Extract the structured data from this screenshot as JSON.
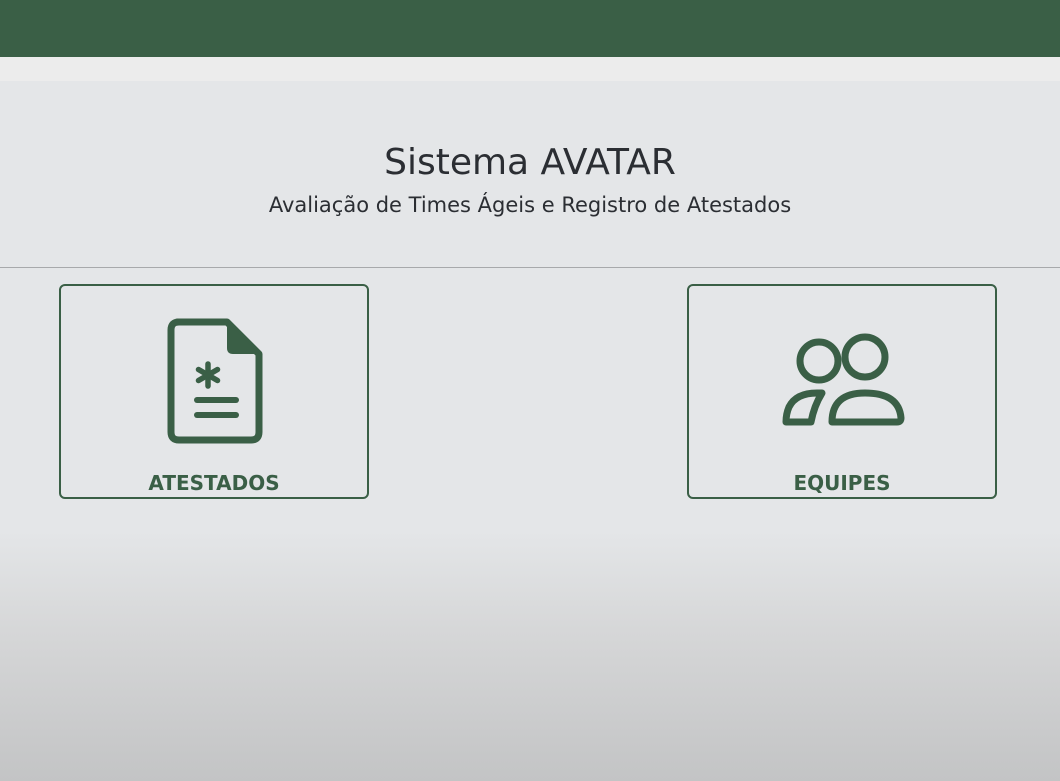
{
  "header": {
    "title": "Sistema AVATAR",
    "subtitle": "Avaliação de Times Ágeis e Registro de Atestados"
  },
  "cards": [
    {
      "label": "ATESTADOS",
      "icon": "medical-document-icon"
    },
    {
      "label": "EQUIPES",
      "icon": "people-group-icon"
    }
  ],
  "colors": {
    "brand": "#3a5f46",
    "text": "#2b2e33",
    "background": "#e4e6e8"
  }
}
